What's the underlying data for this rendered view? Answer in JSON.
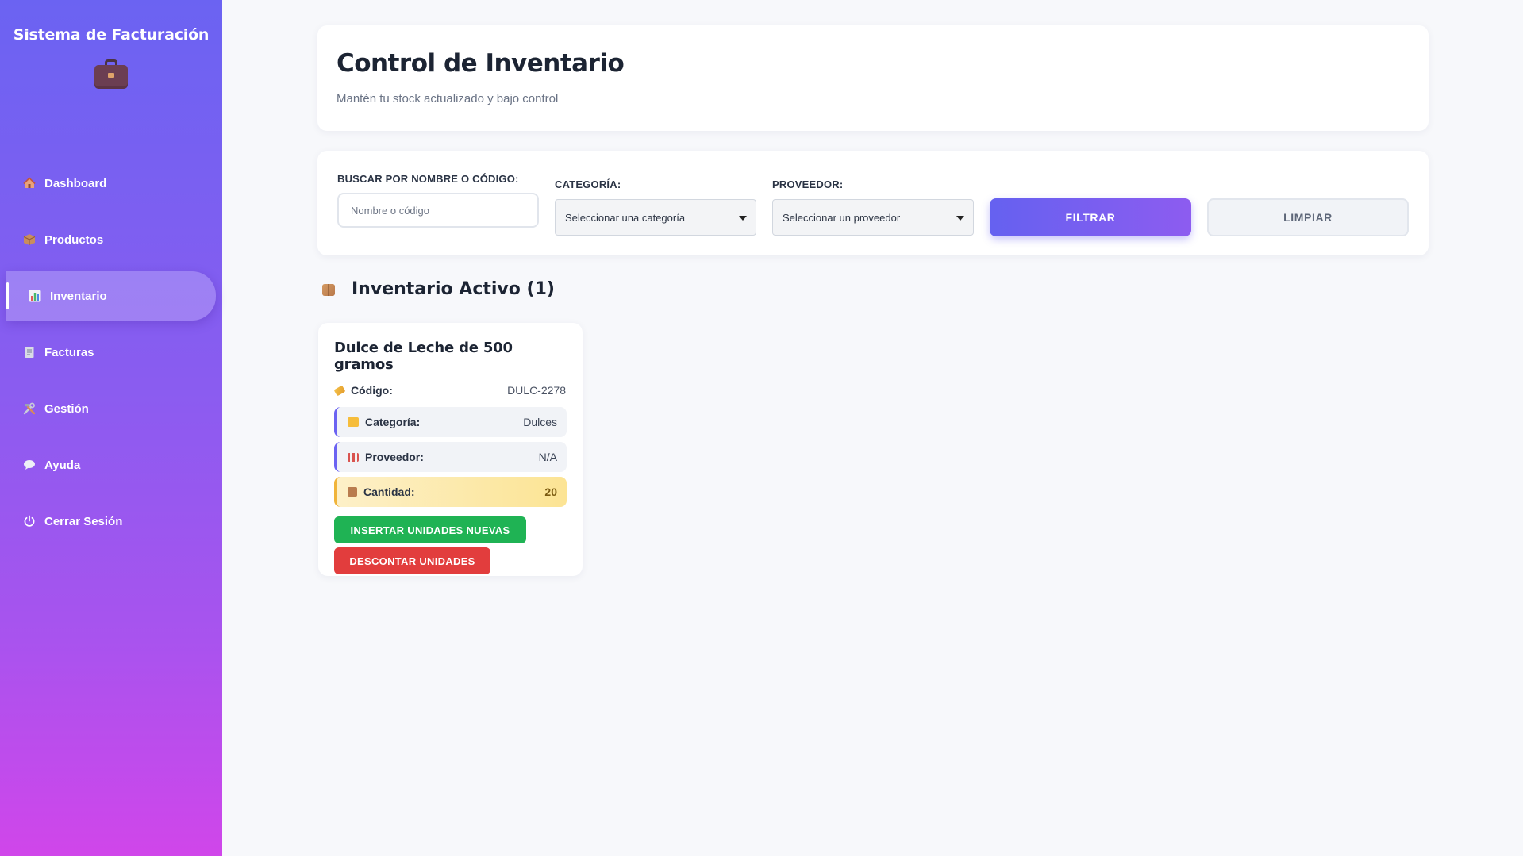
{
  "sidebar": {
    "brand_title": "Sistema de Facturación",
    "brand_icon": "briefcase-icon",
    "items": [
      {
        "label": "Dashboard",
        "icon": "house-icon"
      },
      {
        "label": "Productos",
        "icon": "box-icon"
      },
      {
        "label": "Inventario",
        "icon": "bar-chart-icon",
        "active": true
      },
      {
        "label": "Facturas",
        "icon": "receipt-icon"
      },
      {
        "label": "Gestión",
        "icon": "tools-icon"
      },
      {
        "label": "Ayuda",
        "icon": "speech-bubble-icon"
      },
      {
        "label": "Cerrar Sesión",
        "icon": "power-icon"
      }
    ]
  },
  "header": {
    "title": "Control de Inventario",
    "subtitle": "Mantén tu stock actualizado y bajo control"
  },
  "filters": {
    "search_label": "BUSCAR POR NOMBRE O CÓDIGO:",
    "search_placeholder": "Nombre o código",
    "search_value": "",
    "category_label": "CATEGORÍA:",
    "category_selected": "Seleccionar una categoría",
    "provider_label": "PROVEEDOR:",
    "provider_selected": "Seleccionar un proveedor",
    "filter_button": "FILTRAR",
    "clear_button": "LIMPIAR"
  },
  "inventory": {
    "section_title": "Inventario Activo (1)",
    "products": [
      {
        "name": "Dulce de Leche de 500 gramos",
        "code_label": "Código:",
        "code": "DULC-2278",
        "category_label": "Categoría:",
        "category": "Dulces",
        "provider_label": "Proveedor:",
        "provider": "N/A",
        "quantity_label": "Cantidad:",
        "quantity": "20",
        "insert_button": "INSERTAR UNIDADES NUEVAS",
        "discount_button": "DESCONTAR UNIDADES"
      }
    ]
  },
  "colors": {
    "accent": "#6b63f2",
    "sidebar_gradient_end": "#d046ea",
    "success": "#1fb354",
    "danger": "#e23d3d",
    "warning_bg": "#fce494"
  }
}
